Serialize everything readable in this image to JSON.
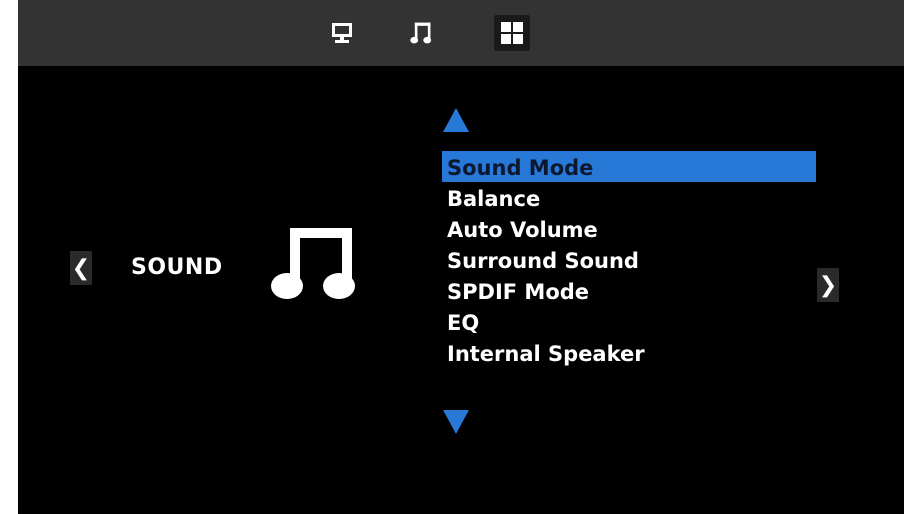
{
  "top_tabs": [
    {
      "id": "display",
      "icon": "monitor-icon"
    },
    {
      "id": "sound",
      "icon": "music-note-icon"
    },
    {
      "id": "apps",
      "icon": "grid-icon"
    }
  ],
  "category": {
    "label": "SOUND",
    "icon": "music-note-icon"
  },
  "nav": {
    "prev_glyph": "❮",
    "next_glyph": "❯"
  },
  "menu": {
    "items": [
      {
        "label": "Sound Mode",
        "selected": true
      },
      {
        "label": "Balance",
        "selected": false
      },
      {
        "label": "Auto Volume",
        "selected": false
      },
      {
        "label": "Surround Sound",
        "selected": false
      },
      {
        "label": "SPDIF Mode",
        "selected": false
      },
      {
        "label": "EQ",
        "selected": false
      },
      {
        "label": "Internal Speaker",
        "selected": false
      }
    ]
  },
  "colors": {
    "accent": "#2878d8",
    "topbar": "#333333",
    "background": "#000000",
    "text": "#ffffff",
    "selected_text": "#0b1830"
  }
}
